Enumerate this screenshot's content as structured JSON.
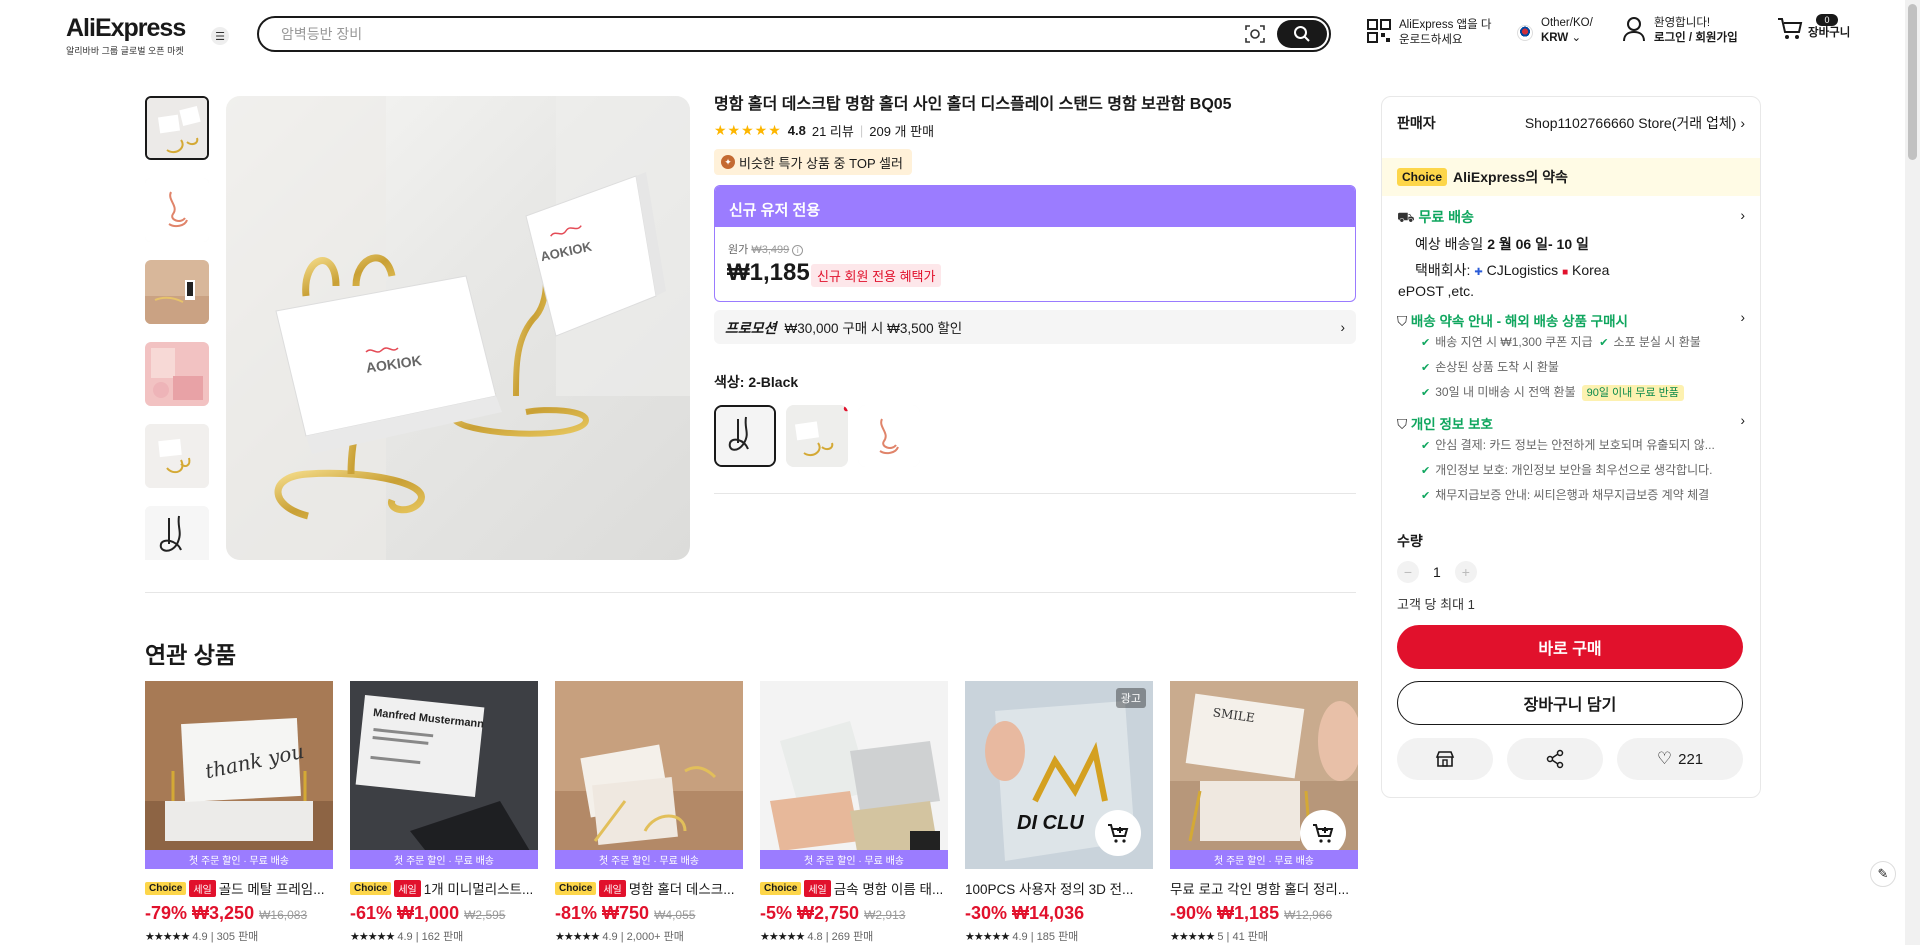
{
  "header": {
    "logo": "AliExpress",
    "logo_sub": "알리바바 그룹 글로벌 오픈 마켓",
    "search_placeholder": "암벽등반 장비",
    "app_line1": "AliExpress 앱을 다",
    "app_line2": "운로드하세요",
    "lang_line1": "Other/KO/",
    "lang_line2": "KRW",
    "user_line1": "환영합니다!",
    "user_line2": "로그인 / 회원가입",
    "cart_count": "0",
    "cart_label": "장바구니"
  },
  "product": {
    "title": "명함 홀더 데스크탑 명함 홀더 사인 홀더 디스플레이 스탠드 명함 보관함 BQ05",
    "rating": "4.8",
    "reviews": "21 리뷰",
    "sold": "209 개 판매",
    "top_badge": "비슷한 특가 상품 중 TOP 셀러",
    "offer_header": "신규 유저 전용",
    "orig_label": "원가",
    "orig_price": "₩3,499",
    "price": "₩1,185",
    "price_badge": "신규 회원 전용 혜택가",
    "promo_label": "프로모션",
    "promo_text": "₩30,000 구매 시 ₩3,500 할인",
    "color_label": "색상:",
    "color_value": "2-Black",
    "image_brand": "AOKIOK"
  },
  "panel": {
    "seller_label": "판매자",
    "seller_name": "Shop1102766660 Store(거래 업체)",
    "choice_badge": "Choice",
    "choice_text": "AliExpress의 약속",
    "shipping_title": "무료 배송",
    "shipping_date_prefix": "예상 배송일",
    "shipping_date": "2 월 06 일- 10 일",
    "courier_label": "택배회사:",
    "courier1": "CJLogistics",
    "courier2": "Korea",
    "courier_more": "ePOST ,etc.",
    "guarantee_title": "배송 약속 안내 - 해외 배송 상품 구매시",
    "g1": "배송 지연 시 ₩1,300 쿠폰 지급",
    "g2": "소포 분실 시 환불",
    "g3": "손상된 상품 도착 시 환불",
    "g4": "30일 내 미배송 시 전액 환불",
    "g4_badge": "90일 이내 무료 반품",
    "privacy_title": "개인 정보 보호",
    "p1": "안심 결제: 카드 정보는 안전하게 보호되며 유출되지 않...",
    "p2": "개인정보 보호: 개인정보 보안을 최우선으로 생각합니다.",
    "p3": "채무지급보증 안내: 씨티은행과 채무지급보증 계약 체결",
    "qty_label": "수량",
    "qty_value": "1",
    "max_qty": "고객 당 최대 1",
    "buy_now": "바로 구매",
    "add_cart": "장바구니 담기",
    "wish_count": "221"
  },
  "related": {
    "title": "연관 상품",
    "strip": "첫 주문 할인 · 무료 배송",
    "choice": "Choice",
    "sale": "세일",
    "ad": "광고",
    "items": [
      {
        "title": "골드 메탈 프레임...",
        "discount": "-79%",
        "price": "₩3,250",
        "orig": "₩16,083",
        "rating": "4.9",
        "sold": "305 판매",
        "img_text": "thank you"
      },
      {
        "title": "1개 미니멀리스트...",
        "discount": "-61%",
        "price": "₩1,000",
        "orig": "₩2,595",
        "rating": "4.9",
        "sold": "162 판매",
        "img_text": "Manfred Mustermann"
      },
      {
        "title": "명함 홀더 데스크...",
        "discount": "-81%",
        "price": "₩750",
        "orig": "₩4,055",
        "rating": "4.9",
        "sold": "2,000+ 판매",
        "img_text": ""
      },
      {
        "title": "금속 명함 이름 태...",
        "discount": "-5%",
        "price": "₩2,750",
        "orig": "₩2,913",
        "rating": "4.8",
        "sold": "269 판매",
        "img_text": ""
      },
      {
        "title": "100PCS 사용자 정의 3D 전...",
        "discount": "-30%",
        "price": "₩14,036",
        "orig": "",
        "rating": "4.9",
        "sold": "185 판매",
        "img_text": "DI CLU"
      },
      {
        "title": "무료 로고 각인 명함 홀더 정리...",
        "discount": "-90%",
        "price": "₩1,185",
        "orig": "₩12,966",
        "rating": "5",
        "sold": "41 판매",
        "img_text": "SMILE"
      }
    ]
  }
}
